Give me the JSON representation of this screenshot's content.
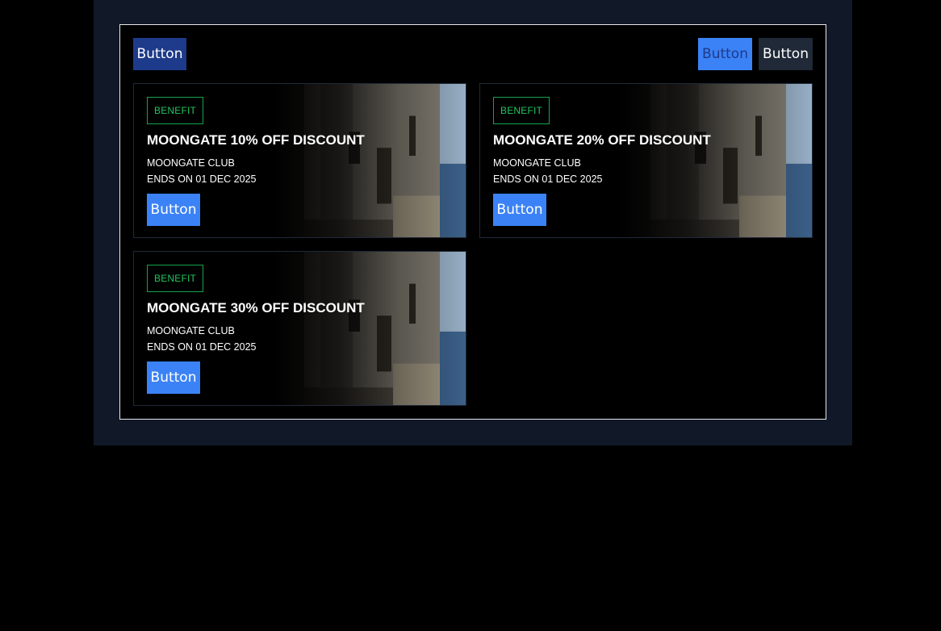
{
  "toolbar": {
    "left_button_label": "Button",
    "right_button_1_label": "Button",
    "right_button_2_label": "Button"
  },
  "cards": [
    {
      "badge": "BENEFIT",
      "title": "MOONGATE 10% OFF DISCOUNT",
      "club": "MOONGATE CLUB",
      "ends": "ENDS ON 01 DEC 2025",
      "button_label": "Button"
    },
    {
      "badge": "BENEFIT",
      "title": "MOONGATE 20% OFF DISCOUNT",
      "club": "MOONGATE CLUB",
      "ends": "ENDS ON 01 DEC 2025",
      "button_label": "Button"
    },
    {
      "badge": "BENEFIT",
      "title": "MOONGATE 30% OFF DISCOUNT",
      "club": "MOONGATE CLUB",
      "ends": "ENDS ON 01 DEC 2025",
      "button_label": "Button"
    }
  ],
  "colors": {
    "page_bg": "#000000",
    "panel_bg": "#111827",
    "accent_blue": "#3b82f6",
    "dark_blue": "#1e3a8a",
    "badge_green": "#22c55e"
  }
}
